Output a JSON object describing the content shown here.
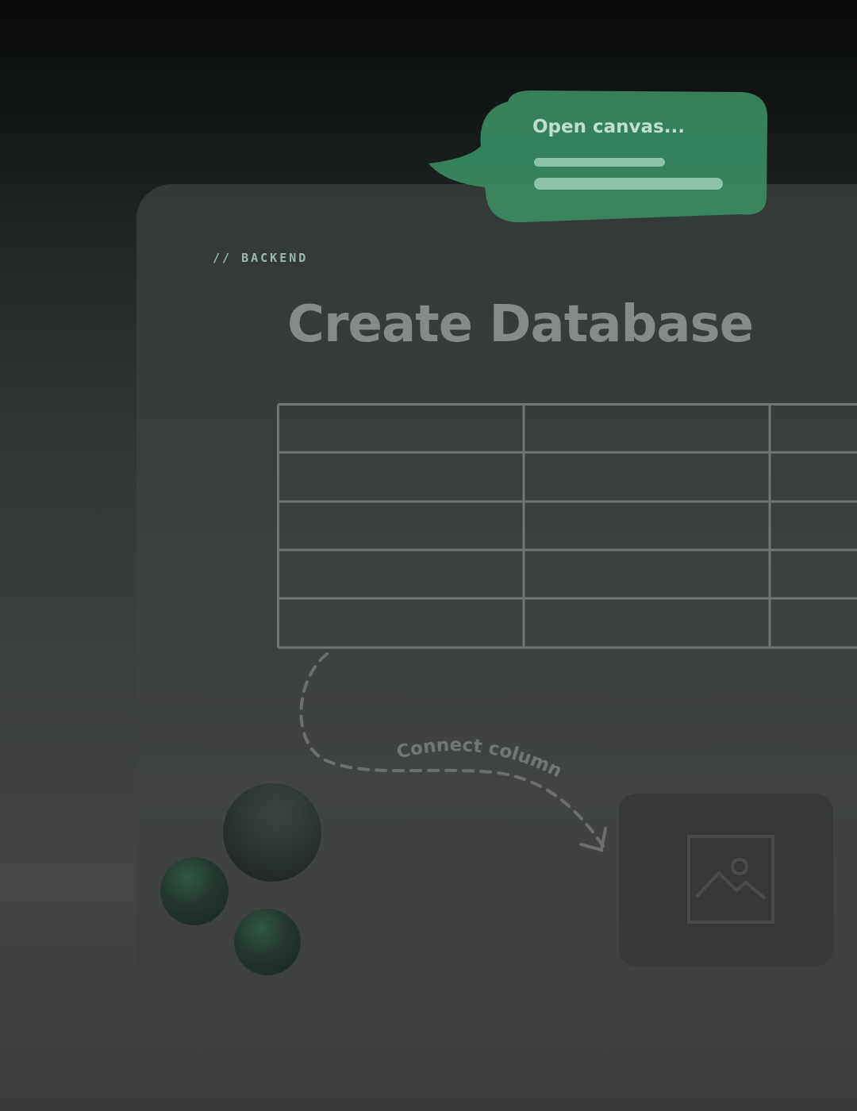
{
  "bubble": {
    "text": "Open canvas..."
  },
  "section": {
    "eyebrow": "// BACKEND"
  },
  "page": {
    "title": "Create Database"
  },
  "connector": {
    "label": "Connect column"
  },
  "table": {
    "rows": 5,
    "visible_columns": 3
  },
  "colors": {
    "bubble": "#3a8a63",
    "accent_text": "#bde0cc",
    "title": "#868a88",
    "grid_line": "#727574"
  },
  "icons": {
    "placeholder": "image-placeholder-icon"
  }
}
